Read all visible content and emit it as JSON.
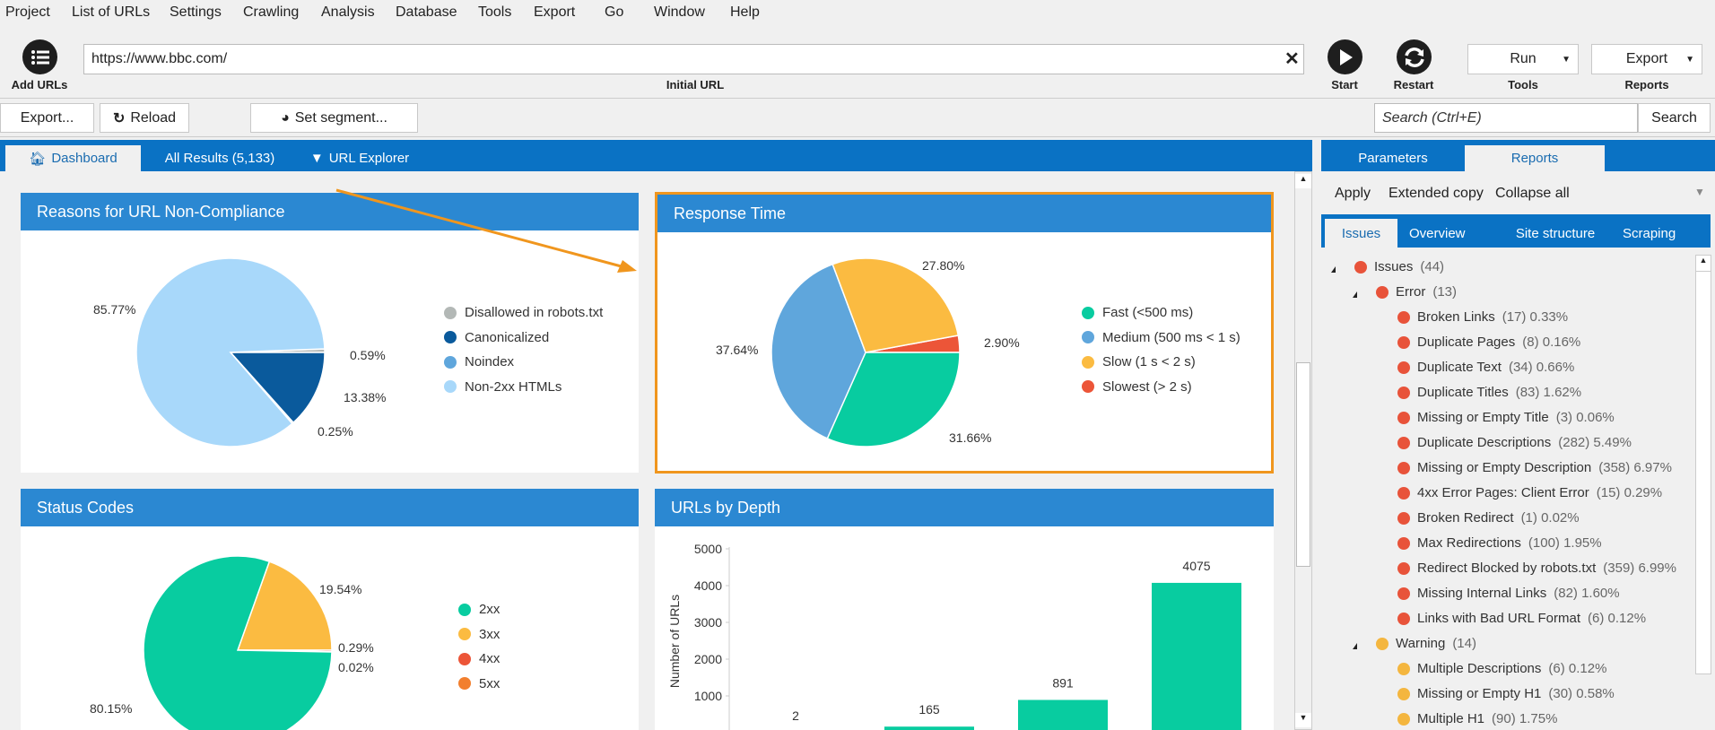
{
  "menu": [
    "Project",
    "List of URLs",
    "Settings",
    "Crawling",
    "Analysis",
    "Database",
    "Tools",
    "Export",
    "Go",
    "Window",
    "Help"
  ],
  "toolbar": {
    "add_urls": "Add URLs",
    "url_value": "https://www.bbc.com/",
    "url_label": "Initial URL",
    "start": "Start",
    "restart": "Restart",
    "run": "Run",
    "tools_label": "Tools",
    "export": "Export",
    "reports_label": "Reports"
  },
  "toolbar2": {
    "export": "Export...",
    "reload": "Reload",
    "set_segment": "Set segment...",
    "search_placeholder": "Search (Ctrl+E)",
    "search": "Search"
  },
  "tabs": [
    "Dashboard",
    "All Results (5,133)",
    "URL Explorer"
  ],
  "right_panel": {
    "tabs": [
      "Parameters",
      "Reports"
    ],
    "actions": [
      "Apply",
      "Extended copy",
      "Collapse all"
    ],
    "subtabs": [
      "Issues",
      "Overview",
      "Site structure",
      "Scraping"
    ],
    "tree": [
      {
        "level": 0,
        "label": "Issues",
        "count": "(44)",
        "pct": "",
        "color": "#e8533a",
        "expand": true
      },
      {
        "level": 1,
        "label": "Error",
        "count": "(13)",
        "pct": "",
        "color": "#e8533a",
        "expand": true
      },
      {
        "level": 2,
        "label": "Broken Links",
        "count": "(17)",
        "pct": "0.33%",
        "color": "#e8533a"
      },
      {
        "level": 2,
        "label": "Duplicate Pages",
        "count": "(8)",
        "pct": "0.16%",
        "color": "#e8533a"
      },
      {
        "level": 2,
        "label": "Duplicate Text",
        "count": "(34)",
        "pct": "0.66%",
        "color": "#e8533a"
      },
      {
        "level": 2,
        "label": "Duplicate Titles",
        "count": "(83)",
        "pct": "1.62%",
        "color": "#e8533a"
      },
      {
        "level": 2,
        "label": "Missing or Empty Title",
        "count": "(3)",
        "pct": "0.06%",
        "color": "#e8533a"
      },
      {
        "level": 2,
        "label": "Duplicate Descriptions",
        "count": "(282)",
        "pct": "5.49%",
        "color": "#e8533a"
      },
      {
        "level": 2,
        "label": "Missing or Empty Description",
        "count": "(358)",
        "pct": "6.97%",
        "color": "#e8533a"
      },
      {
        "level": 2,
        "label": "4xx Error Pages: Client Error",
        "count": "(15)",
        "pct": "0.29%",
        "color": "#e8533a"
      },
      {
        "level": 2,
        "label": "Broken Redirect",
        "count": "(1)",
        "pct": "0.02%",
        "color": "#e8533a"
      },
      {
        "level": 2,
        "label": "Max Redirections",
        "count": "(100)",
        "pct": "1.95%",
        "color": "#e8533a"
      },
      {
        "level": 2,
        "label": "Redirect Blocked by robots.txt",
        "count": "(359)",
        "pct": "6.99%",
        "color": "#e8533a"
      },
      {
        "level": 2,
        "label": "Missing Internal Links",
        "count": "(82)",
        "pct": "1.60%",
        "color": "#e8533a"
      },
      {
        "level": 2,
        "label": "Links with Bad URL Format",
        "count": "(6)",
        "pct": "0.12%",
        "color": "#e8533a"
      },
      {
        "level": 1,
        "label": "Warning",
        "count": "(14)",
        "pct": "",
        "color": "#f4b63f",
        "expand": true
      },
      {
        "level": 2,
        "label": "Multiple Descriptions",
        "count": "(6)",
        "pct": "0.12%",
        "color": "#f4b63f"
      },
      {
        "level": 2,
        "label": "Missing or Empty H1",
        "count": "(30)",
        "pct": "0.58%",
        "color": "#f4b63f"
      },
      {
        "level": 2,
        "label": "Multiple H1",
        "count": "(90)",
        "pct": "1.75%",
        "color": "#f4b63f"
      }
    ]
  },
  "chart_data": [
    {
      "type": "pie",
      "title": "Reasons for URL Non-Compliance",
      "slices": [
        {
          "name": "Disallowed in robots.txt",
          "value": 0.59,
          "label": "0.59%",
          "color": "#b3b8b6"
        },
        {
          "name": "Canonicalized",
          "value": 13.38,
          "label": "13.38%",
          "color": "#0a5a9c"
        },
        {
          "name": "Noindex",
          "value": 0.25,
          "label": "0.25%",
          "color": "#5fa6dc"
        },
        {
          "name": "Non-2xx HTMLs",
          "value": 85.77,
          "label": "85.77%",
          "color": "#a8d8fa"
        }
      ]
    },
    {
      "type": "pie",
      "title": "Response Time",
      "slices": [
        {
          "name": "Slowest (> 2 s)",
          "value": 2.9,
          "label": "2.90%",
          "color": "#ec5538"
        },
        {
          "name": "Fast (<500 ms)",
          "value": 31.66,
          "label": "31.66%",
          "color": "#08cca0"
        },
        {
          "name": "Medium (500 ms < 1 s)",
          "value": 37.64,
          "label": "37.64%",
          "color": "#5fa6dc"
        },
        {
          "name": "Slow (1 s < 2 s)",
          "value": 27.8,
          "label": "27.80%",
          "color": "#fbbb41"
        }
      ],
      "legend_order": [
        "Fast (<500 ms)",
        "Medium (500 ms < 1 s)",
        "Slow (1 s < 2 s)",
        "Slowest (> 2 s)"
      ]
    },
    {
      "type": "pie",
      "title": "Status Codes",
      "slices": [
        {
          "name": "3xx",
          "value": 19.54,
          "label": "19.54%",
          "color": "#fbbb41"
        },
        {
          "name": "4xx",
          "value": 0.29,
          "label": "0.29%",
          "color": "#ec5538"
        },
        {
          "name": "5xx",
          "value": 0.02,
          "label": "0.02%",
          "color": "#f27f2e"
        },
        {
          "name": "2xx",
          "value": 80.15,
          "label": "80.15%",
          "color": "#08cca0"
        }
      ],
      "legend_order": [
        "2xx",
        "3xx",
        "4xx",
        "5xx"
      ]
    },
    {
      "type": "bar",
      "title": "URLs by Depth",
      "ylabel": "Number of URLs",
      "ylim": [
        0,
        5000
      ],
      "yticks": [
        "5000",
        "4000",
        "3000",
        "2000",
        "1000"
      ],
      "values": [
        2,
        165,
        891,
        4075
      ],
      "color": "#08cca0"
    }
  ],
  "accent_color": "#0a72c4",
  "highlight_color": "#f0961e"
}
